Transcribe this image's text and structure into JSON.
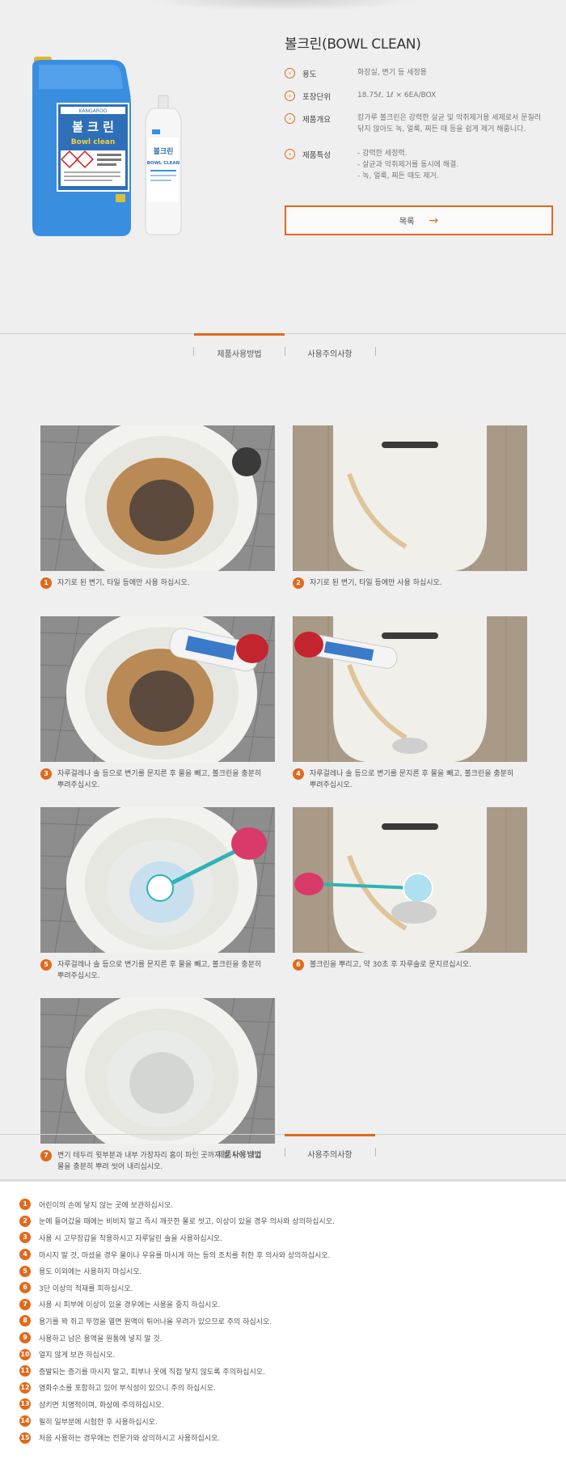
{
  "product": {
    "title": "볼크린(BOWL CLEAN)",
    "specs": [
      {
        "label": "용도",
        "lines": [
          "화장실, 변기 등 세정용"
        ]
      },
      {
        "label": "포장단위",
        "lines": [
          "18.75ℓ, 1ℓ × 6EA/BOX"
        ]
      },
      {
        "label": "제품개요",
        "lines": [
          "캉가루 볼크린은 강력한 살균 및 악취제거용 세제로서 문질러",
          "닦지 않아도 녹, 얼룩, 찌든 때 등을 쉽게 제거 해줍니다."
        ]
      },
      {
        "label": "제품특성",
        "lines": [
          "- 강력한 세정력.",
          "- 살균과 악취제거를 동시에 해결.",
          "- 녹, 얼룩, 찌든 때도 제거."
        ]
      }
    ],
    "list_button": "목록",
    "jug_brand": "KANGAROO",
    "jug_name": "볼 크 린",
    "jug_name_en": "Bowl clean",
    "bottle_name": "볼크린",
    "bottle_name_en": "BOWL CLEAN"
  },
  "tabs": [
    "제품사용방법",
    "사용주의사항"
  ],
  "steps": [
    {
      "num": "1",
      "lines": [
        "자기로 된 변기, 타일 등에만 사용 하십시오."
      ],
      "kind": "toilet-stain"
    },
    {
      "num": "2",
      "lines": [
        "자기로 된 변기, 타일 등에만 사용 하십시오."
      ],
      "kind": "urinal-stain"
    },
    {
      "num": "3",
      "lines": [
        "자루걸레나 솔 등으로 변기를 문지른 후 물을 빼고, 볼크린을 충분히",
        "뿌려주십시오."
      ],
      "kind": "toilet-pour"
    },
    {
      "num": "4",
      "lines": [
        "자루걸레나 솔 등으로 변기를 문지른 후 물을 빼고, 볼크린을 충분히",
        "뿌려주십시오."
      ],
      "kind": "urinal-pour"
    },
    {
      "num": "5",
      "lines": [
        "자루걸레나 솔 등으로 변기를 문지른 후 물을 빼고, 볼크린을 충분히",
        "뿌려주십시오."
      ],
      "kind": "toilet-brush"
    },
    {
      "num": "6",
      "lines": [
        "볼크린을 뿌리고, 약 30초 후 자루솔로 문지르십시오."
      ],
      "kind": "urinal-brush"
    },
    {
      "num": "7",
      "lines": [
        "변기 테두리 윗부분과 내부 가장자리 홈이 파인 곳까지 잘 닦아 내고",
        "물을 충분히 뿌려 씻어 내리십시오."
      ],
      "kind": "toilet-clean"
    }
  ],
  "cautions": [
    "어린이의 손에 닿지 않는 곳에 보관하십시오.",
    "눈에 들어갔을 때에는 비비지 말고 즉시 깨끗한 물로 씻고, 이상이 있을 경우 의사와 상의하십시오.",
    "사용 시 고무장갑을 착용하시고 자루달린 솔을 사용하십시오.",
    "마시지 말 것, 마셨을 경우 물이나 우유를 마시게 하는 등의 조치를 취한 후 의사와 상의하십시오.",
    "용도 이외에는 사용하지 마십시오.",
    "3단 이상의 적재를 피하십시오.",
    "사용 시 피부에 이상이 있을 경우에는 사용을 중지 하십시오.",
    "용기를 꽉 쥐고 뚜껑을 열면 원액이 튀어나올 우려가 있으므로 주의 하십시오.",
    "사용하고 남은 용액을 원통에 넣지 말 것.",
    "얼지 않게 보관 하십시오.",
    "증발되는 증기를 마시지 말고, 피부나 옷에 직접 닿지 않도록 주의하십시오.",
    "염화수소를 포함하고 있어 부식성이 있으니 주의 하십시오.",
    "삼키면 치명적이며, 화상에 주의하십시오.",
    "필히 일부분에 시험한 후 사용하십시오.",
    "처음 사용하는 경우에는 전문가와 상의하시고 사용하십시오."
  ],
  "colors": {
    "accent": "#e06a1b",
    "jug_blue": "#3a8ee0"
  }
}
